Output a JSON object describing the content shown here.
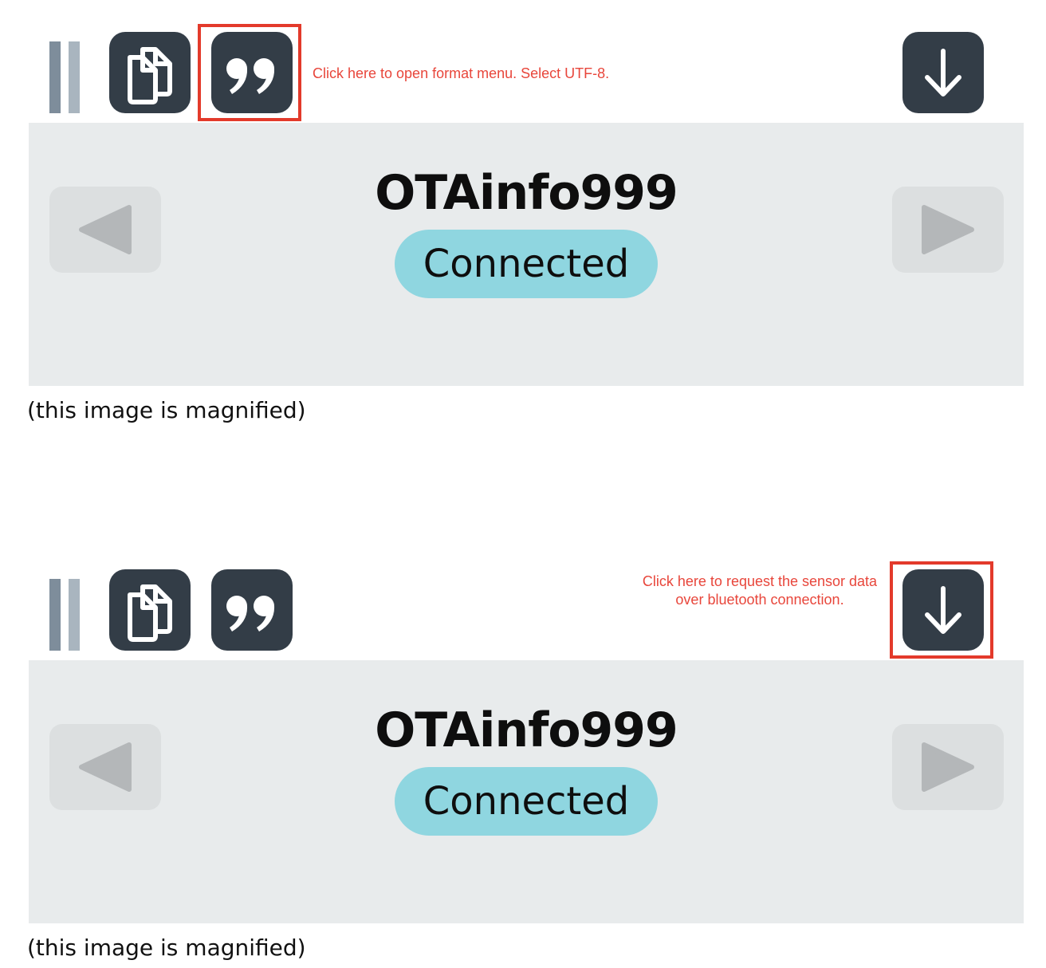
{
  "panels": [
    {
      "toolbar": {
        "pause_icon": "pause-icon",
        "copy_icon": "copy-documents-icon",
        "format_icon": "quote-icon",
        "download_icon": "download-arrow-icon"
      },
      "annotation": {
        "text": "Click here to open format menu. Select UTF-8.",
        "highlight_target": "format-button",
        "color": "#e8463b"
      },
      "device": {
        "name": "OTAinfo999",
        "status": "Connected",
        "status_color": "#8fd6e0",
        "prev_icon": "triangle-left-icon",
        "next_icon": "triangle-right-icon"
      },
      "caption": "(this image is magnified)"
    },
    {
      "toolbar": {
        "pause_icon": "pause-icon",
        "copy_icon": "copy-documents-icon",
        "format_icon": "quote-icon",
        "download_icon": "download-arrow-icon"
      },
      "annotation": {
        "text": "Click here to request the sensor data over bluetooth connection.",
        "highlight_target": "download-button",
        "color": "#e8463b"
      },
      "device": {
        "name": "OTAinfo999",
        "status": "Connected",
        "status_color": "#8fd6e0",
        "prev_icon": "triangle-left-icon",
        "next_icon": "triangle-right-icon"
      },
      "caption": "(this image is magnified)"
    }
  ],
  "colors": {
    "button_dark": "#333d47",
    "card_background": "#e8ebec",
    "highlight_border": "#e33a2b"
  }
}
